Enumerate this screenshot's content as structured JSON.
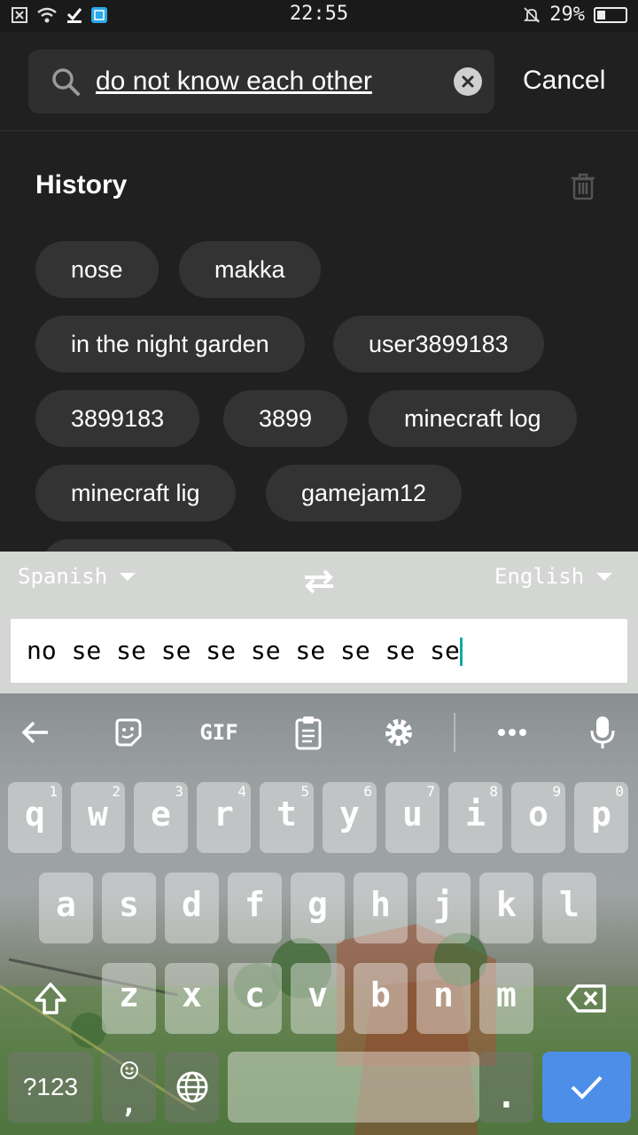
{
  "status_bar": {
    "time": "22:55",
    "battery_text": "29%",
    "battery_level": 0.29
  },
  "search": {
    "query": "do not know each other",
    "cancel_label": "Cancel"
  },
  "history": {
    "title": "History",
    "chips": [
      "nose",
      "makka",
      "in the night garden",
      "user3899183",
      "3899183",
      "3899",
      "minecraft log",
      "minecraft lig",
      "gamejam12"
    ]
  },
  "translate": {
    "source_lang": "Spanish",
    "target_lang": "English",
    "text": "no se se se se se se se se se"
  },
  "keyboard": {
    "toolbar": {
      "gif_label": "GIF"
    },
    "row1": [
      {
        "key": "q",
        "hint": "1"
      },
      {
        "key": "w",
        "hint": "2"
      },
      {
        "key": "e",
        "hint": "3"
      },
      {
        "key": "r",
        "hint": "4"
      },
      {
        "key": "t",
        "hint": "5"
      },
      {
        "key": "y",
        "hint": "6"
      },
      {
        "key": "u",
        "hint": "7"
      },
      {
        "key": "i",
        "hint": "8"
      },
      {
        "key": "o",
        "hint": "9"
      },
      {
        "key": "p",
        "hint": "0"
      }
    ],
    "row2": [
      "a",
      "s",
      "d",
      "f",
      "g",
      "h",
      "j",
      "k",
      "l"
    ],
    "row3": [
      "z",
      "x",
      "c",
      "v",
      "b",
      "n",
      "m"
    ],
    "symbols_label": "?123",
    "emoji_comma_label": ",",
    "period_label": "."
  },
  "colors": {
    "background": "#202020",
    "chip": "#333333",
    "enter_key": "#4c8ee8"
  }
}
